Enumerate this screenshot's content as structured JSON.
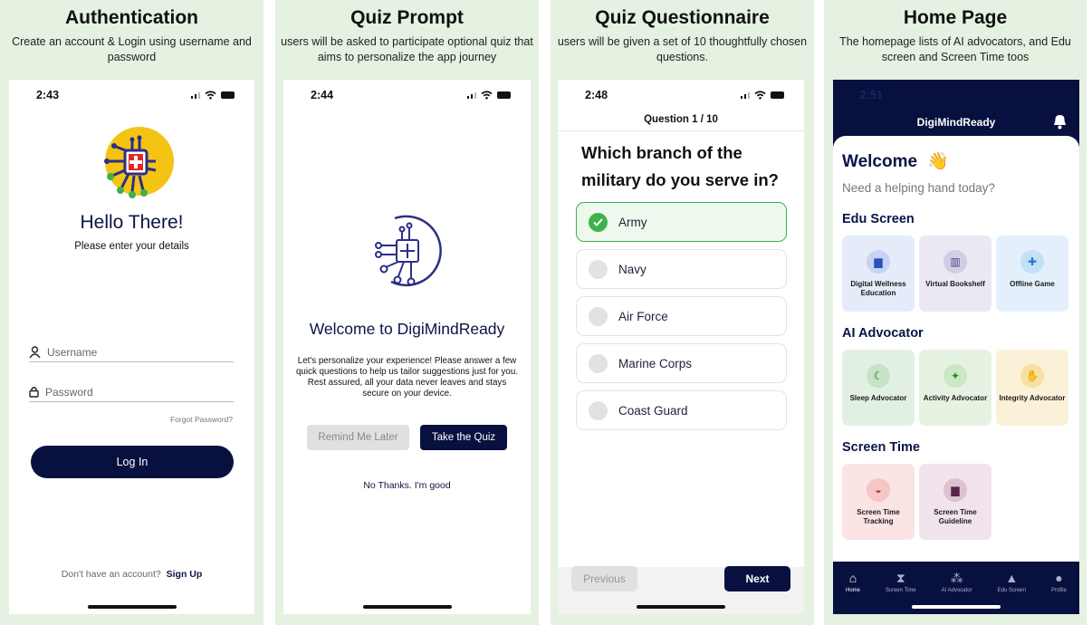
{
  "colors": {
    "navy": "#08103f",
    "panel_bg": "#e5f1e1",
    "green": "#3db24a",
    "yellow": "#f4c414"
  },
  "panels": [
    {
      "title": "Authentication",
      "subtitle": "Create an account & Login using username and password"
    },
    {
      "title": "Quiz Prompt",
      "subtitle": "users will be asked to participate optional quiz that aims to personalize the app journey"
    },
    {
      "title": "Quiz Questionnaire",
      "subtitle": "users will be given a set of 10 thoughtfully chosen questions."
    },
    {
      "title": "Home Page",
      "subtitle": "The homepage lists of AI advocators, and Edu screen and Screen Time toos"
    }
  ],
  "auth": {
    "time": "2:43",
    "heading": "Hello There!",
    "subheading": "Please enter your details",
    "username_placeholder": "Username",
    "password_placeholder": "Password",
    "forgot": "Forgot Password?",
    "login": "Log In",
    "no_account": "Don't have an account?",
    "signup": "Sign Up"
  },
  "prompt": {
    "time": "2:44",
    "heading": "Welcome to DigiMindReady",
    "body": "Let's personalize your experience! Please answer a few quick questions to help us tailor suggestions just for you. Rest assured, all your data never leaves and stays secure on your device.",
    "remind": "Remind Me Later",
    "take": "Take the Quiz",
    "no_thanks": "No Thanks. I'm good"
  },
  "quiz": {
    "time": "2:48",
    "progress": "Question 1 / 10",
    "question": "Which branch of the military do you serve in?",
    "options": [
      {
        "label": "Army",
        "selected": true
      },
      {
        "label": "Navy",
        "selected": false
      },
      {
        "label": "Air Force",
        "selected": false
      },
      {
        "label": "Marine Corps",
        "selected": false
      },
      {
        "label": "Coast Guard",
        "selected": false
      }
    ],
    "previous": "Previous",
    "next": "Next"
  },
  "home": {
    "time": "2:51",
    "app_name": "DigiMindReady",
    "welcome": "Welcome",
    "wave": "👋",
    "tagline": "Need a helping hand today?",
    "edu_title": "Edu Screen",
    "edu_items": [
      "Digital Wellness Education",
      "Virtual Bookshelf",
      "Offline Game"
    ],
    "ai_title": "AI Advocator",
    "ai_items": [
      "Sleep Advocator",
      "Activity Advocator",
      "Integrity Advocator"
    ],
    "st_title": "Screen Time",
    "st_items": [
      "Screen Time Tracking",
      "Screen Time Guideline"
    ],
    "nav": [
      {
        "label": "Home",
        "icon": "home-icon"
      },
      {
        "label": "Screen Time",
        "icon": "hourglass-icon"
      },
      {
        "label": "AI Advocator",
        "icon": "sparkle-icon"
      },
      {
        "label": "Edu Screen",
        "icon": "graduation-cap-icon"
      },
      {
        "label": "Profile",
        "icon": "person-icon"
      }
    ]
  }
}
